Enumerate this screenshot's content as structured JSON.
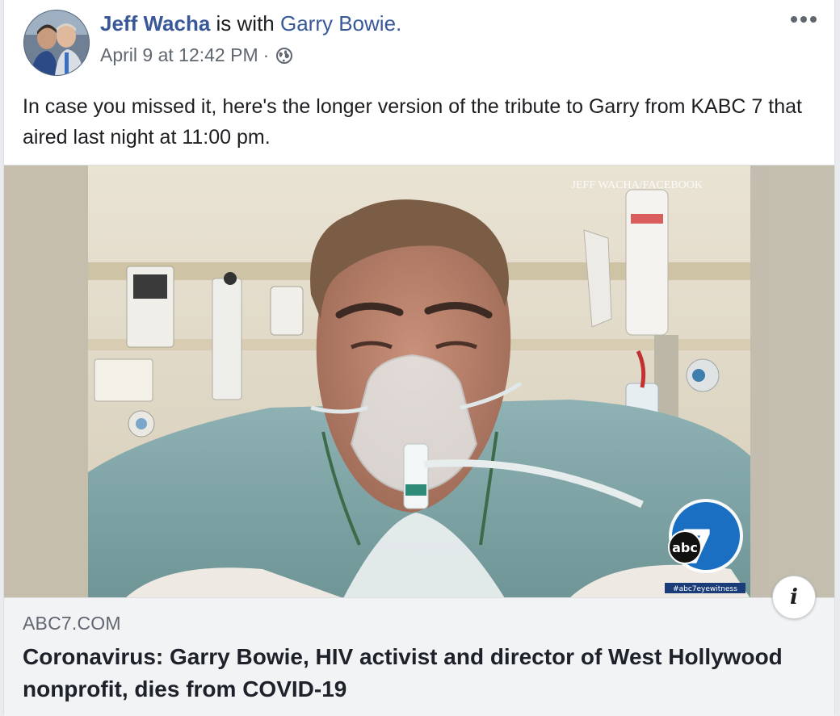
{
  "post": {
    "author": "Jeff Wacha",
    "with_text": " is with ",
    "tagged": "Garry Bowie",
    "tagged_suffix": ".",
    "timestamp": "April 9 at 12:42 PM",
    "separator": "·",
    "privacy_icon": "globe-icon",
    "more_icon": "more-options-icon",
    "text": "In case you missed it, here's the longer version of the tribute to Garry from KABC 7 that aired last night at 11:00 pm."
  },
  "media": {
    "watermark": "JEFF WACHA/FACEBOOK",
    "network_logo_text": "abc",
    "network_channel": "7",
    "hashtag": "#abc7eyewitness",
    "info_icon": "i"
  },
  "link": {
    "domain": "ABC7.COM",
    "title": "Coronavirus: Garry Bowie, HIV activist and director of West Hollywood nonprofit, dies from COVID-19"
  },
  "colors": {
    "link_blue": "#385898",
    "meta_grey": "#606770",
    "text": "#1c1e21",
    "footer_bg": "#f2f3f5"
  }
}
